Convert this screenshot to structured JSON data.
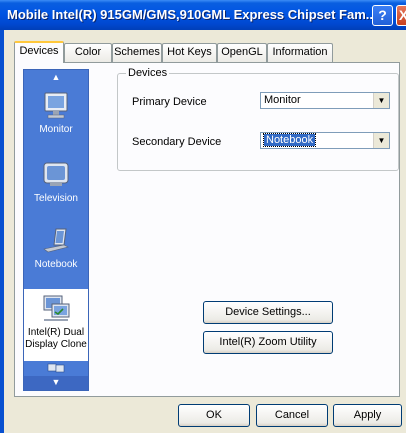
{
  "window": {
    "title": "Mobile Intel(R) 915GM/GMS,910GML Express Chipset Fam...",
    "help_glyph": "?",
    "close_glyph": "X"
  },
  "tabs": [
    {
      "label": "Devices",
      "active": true
    },
    {
      "label": "Color",
      "active": false
    },
    {
      "label": "Schemes",
      "active": false
    },
    {
      "label": "Hot Keys",
      "active": false
    },
    {
      "label": "OpenGL",
      "active": false
    },
    {
      "label": "Information",
      "active": false
    }
  ],
  "sidebar": {
    "scroll_up": "▲",
    "scroll_down": "▼",
    "items": [
      {
        "label": "Monitor",
        "icon": "monitor-icon"
      },
      {
        "label": "Television",
        "icon": "television-icon"
      },
      {
        "label": "Notebook",
        "icon": "notebook-icon"
      },
      {
        "label": "Intel(R) Dual Display Clone",
        "icon": "dual-display-clone-icon",
        "selected": true
      }
    ]
  },
  "devices_group": {
    "legend": "Devices",
    "primary_label": "Primary Device",
    "primary_value": "Monitor",
    "secondary_label": "Secondary Device",
    "secondary_value": "Notebook"
  },
  "actions": {
    "device_settings": "Device Settings...",
    "zoom_utility": "Intel(R) Zoom Utility"
  },
  "footer": {
    "ok": "OK",
    "cancel": "Cancel",
    "apply": "Apply"
  },
  "colors": {
    "titlebar": "#0054e3",
    "sidebar": "#4a7bd6",
    "tab_highlight": "#ffc83c",
    "dialog_bg": "#ece9d8"
  }
}
